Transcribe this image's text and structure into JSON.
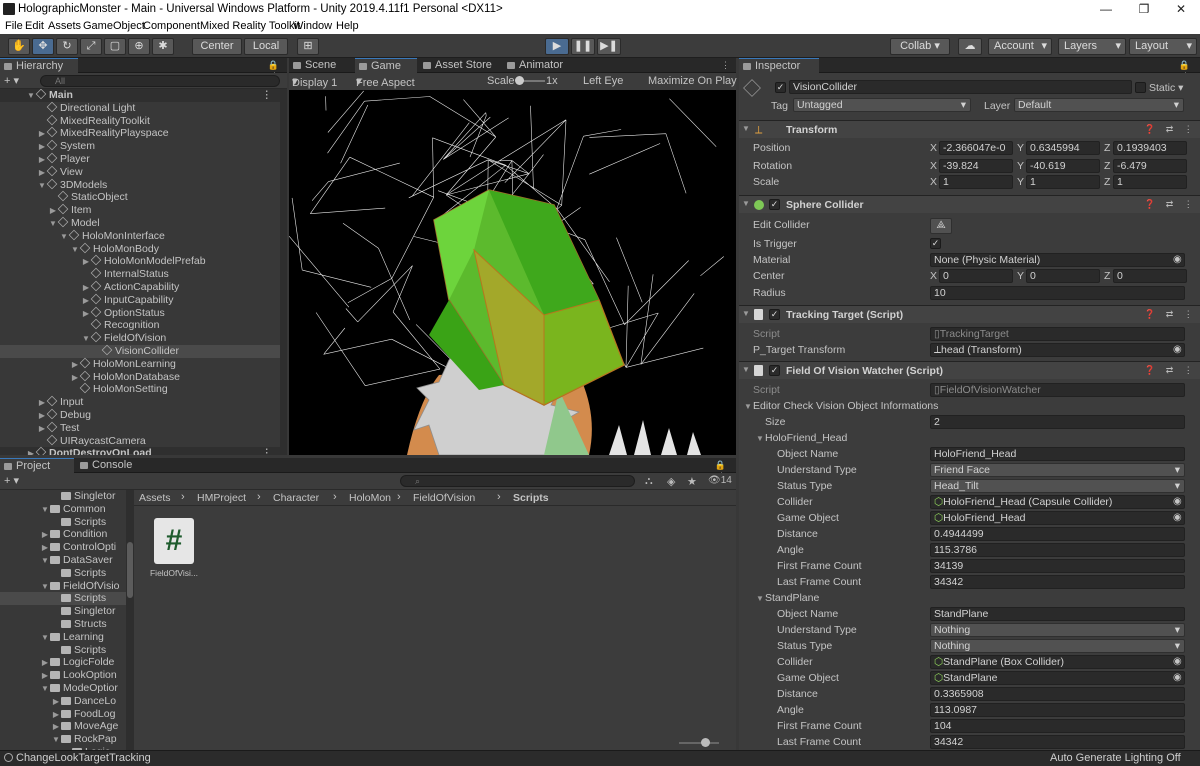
{
  "window": {
    "title": "HolographicMonster - Main - Universal Windows Platform - Unity 2019.4.11f1 Personal <DX11>",
    "minimize": "—",
    "maximize": "❐",
    "close": "✕"
  },
  "menu": [
    "File",
    "Edit",
    "Assets",
    "GameObject",
    "Component",
    "Mixed Reality Toolkit",
    "Window",
    "Help"
  ],
  "toolbar": {
    "center": "Center",
    "local": "Local",
    "collab": "Collab ▾",
    "account": "Account",
    "layers": "Layers",
    "layout": "Layout",
    "cloud_icon": "cloud-icon"
  },
  "hierarchy": {
    "tab": "Hierarchy",
    "add": "+ ▾",
    "search_placeholder": "All",
    "rows": [
      {
        "label": "Main",
        "depth": 0,
        "arrow": "▼",
        "scene": true
      },
      {
        "label": "Directional Light",
        "depth": 1,
        "arrow": ""
      },
      {
        "label": "MixedRealityToolkit",
        "depth": 1,
        "arrow": ""
      },
      {
        "label": "MixedRealityPlayspace",
        "depth": 1,
        "arrow": "▶"
      },
      {
        "label": "System",
        "depth": 1,
        "arrow": "▶"
      },
      {
        "label": "Player",
        "depth": 1,
        "arrow": "▶"
      },
      {
        "label": "View",
        "depth": 1,
        "arrow": "▶"
      },
      {
        "label": "3DModels",
        "depth": 1,
        "arrow": "▼"
      },
      {
        "label": "StaticObject",
        "depth": 2,
        "arrow": ""
      },
      {
        "label": "Item",
        "depth": 2,
        "arrow": "▶"
      },
      {
        "label": "Model",
        "depth": 2,
        "arrow": "▼"
      },
      {
        "label": "HoloMonInterface",
        "depth": 3,
        "arrow": "▼"
      },
      {
        "label": "HoloMonBody",
        "depth": 4,
        "arrow": "▼"
      },
      {
        "label": "HoloMonModelPrefab",
        "depth": 5,
        "arrow": "▶"
      },
      {
        "label": "InternalStatus",
        "depth": 5,
        "arrow": ""
      },
      {
        "label": "ActionCapability",
        "depth": 5,
        "arrow": "▶"
      },
      {
        "label": "InputCapability",
        "depth": 5,
        "arrow": "▶"
      },
      {
        "label": "OptionStatus",
        "depth": 5,
        "arrow": "▶"
      },
      {
        "label": "Recognition",
        "depth": 5,
        "arrow": ""
      },
      {
        "label": "FieldOfVision",
        "depth": 5,
        "arrow": "▼"
      },
      {
        "label": "VisionCollider",
        "depth": 6,
        "arrow": "",
        "selected": true
      },
      {
        "label": "HoloMonLearning",
        "depth": 4,
        "arrow": "▶"
      },
      {
        "label": "HoloMonDatabase",
        "depth": 4,
        "arrow": "▶"
      },
      {
        "label": "HoloMonSetting",
        "depth": 4,
        "arrow": ""
      },
      {
        "label": "Input",
        "depth": 1,
        "arrow": "▶"
      },
      {
        "label": "Debug",
        "depth": 1,
        "arrow": "▶"
      },
      {
        "label": "Test",
        "depth": 1,
        "arrow": "▶"
      },
      {
        "label": "UIRaycastCamera",
        "depth": 1,
        "arrow": ""
      },
      {
        "label": "DontDestroyOnLoad",
        "depth": 0,
        "arrow": "▶",
        "scene": true
      }
    ]
  },
  "scene_tabs": {
    "scene": "Scene",
    "game": "Game",
    "asset_store": "Asset Store",
    "animator": "Animator"
  },
  "game_toolbar": {
    "display": "Display 1",
    "aspect": "Free Aspect",
    "scale_label": "Scale",
    "scale_value": "1x",
    "eye": "Left Eye",
    "maximize": "Maximize On Play"
  },
  "project": {
    "tab_project": "Project",
    "tab_console": "Console",
    "add": "+ ▾",
    "count": "14",
    "breadcrumb": [
      "Assets",
      "HMProject",
      "Character",
      "HoloMon",
      "FieldOfVision",
      "Scripts"
    ],
    "file": "FieldOfVisi...",
    "tree": [
      {
        "label": "Singletor",
        "depth": 3,
        "arrow": ""
      },
      {
        "label": "Common",
        "depth": 2,
        "arrow": "▼"
      },
      {
        "label": "Scripts",
        "depth": 3,
        "arrow": ""
      },
      {
        "label": "Condition",
        "depth": 2,
        "arrow": "▶"
      },
      {
        "label": "ControlOpti",
        "depth": 2,
        "arrow": "▶"
      },
      {
        "label": "DataSaver",
        "depth": 2,
        "arrow": "▼"
      },
      {
        "label": "Scripts",
        "depth": 3,
        "arrow": ""
      },
      {
        "label": "FieldOfVisio",
        "depth": 2,
        "arrow": "▼"
      },
      {
        "label": "Scripts",
        "depth": 3,
        "arrow": "",
        "selected": true
      },
      {
        "label": "Singletor",
        "depth": 3,
        "arrow": ""
      },
      {
        "label": "Structs",
        "depth": 3,
        "arrow": ""
      },
      {
        "label": "Learning",
        "depth": 2,
        "arrow": "▼"
      },
      {
        "label": "Scripts",
        "depth": 3,
        "arrow": ""
      },
      {
        "label": "LogicFolde",
        "depth": 2,
        "arrow": "▶"
      },
      {
        "label": "LookOption",
        "depth": 2,
        "arrow": "▶"
      },
      {
        "label": "ModeOptior",
        "depth": 2,
        "arrow": "▼"
      },
      {
        "label": "DanceLo",
        "depth": 3,
        "arrow": "▶"
      },
      {
        "label": "FoodLog",
        "depth": 3,
        "arrow": "▶"
      },
      {
        "label": "MoveAge",
        "depth": 3,
        "arrow": "▶"
      },
      {
        "label": "RockPap",
        "depth": 3,
        "arrow": "▼"
      },
      {
        "label": "Logic",
        "depth": 4,
        "arrow": ""
      }
    ]
  },
  "inspector": {
    "tab": "Inspector",
    "object_name": "VisionCollider",
    "static_label": "Static ▾",
    "tag_label": "Tag",
    "tag_value": "Untagged",
    "layer_label": "Layer",
    "layer_value": "Default",
    "transform": {
      "title": "Transform",
      "position": {
        "label": "Position",
        "x": "-2.366047e-0",
        "y": "0.6345994",
        "z": "0.1939403"
      },
      "rotation": {
        "label": "Rotation",
        "x": "-39.824",
        "y": "-40.619",
        "z": "-6.479"
      },
      "scale": {
        "label": "Scale",
        "x": "1",
        "y": "1",
        "z": "1"
      }
    },
    "sphere": {
      "title": "Sphere Collider",
      "edit": "Edit Collider",
      "trigger": "Is Trigger",
      "material_label": "Material",
      "material_value": "None (Physic Material)",
      "center_label": "Center",
      "cx": "0",
      "cy": "0",
      "cz": "0",
      "radius_label": "Radius",
      "radius_value": "10"
    },
    "tracking": {
      "title": "Tracking Target (Script)",
      "script_label": "Script",
      "script_value": "TrackingTarget",
      "target_label": "P_Target Transform",
      "target_value": "head (Transform)"
    },
    "fov": {
      "title": "Field Of Vision Watcher (Script)",
      "script_label": "Script",
      "script_value": "FieldOfVisionWatcher",
      "section": "Editor Check Vision Object Informations",
      "size_label": "Size",
      "size_value": "2",
      "items": [
        {
          "name": "HoloFriend_Head",
          "fields": [
            [
              "Object Name",
              "HoloFriend_Head",
              "t"
            ],
            [
              "Understand Type",
              "Friend Face",
              "d"
            ],
            [
              "Status Type",
              "Head_Tilt",
              "d"
            ],
            [
              "Collider",
              "HoloFriend_Head (Capsule Collider)",
              "o"
            ],
            [
              "Game Object",
              "HoloFriend_Head",
              "o"
            ],
            [
              "Distance",
              "0.4944499",
              "t"
            ],
            [
              "Angle",
              "115.3786",
              "t"
            ],
            [
              "First Frame Count",
              "34139",
              "t"
            ],
            [
              "Last Frame Count",
              "34342",
              "t"
            ]
          ]
        },
        {
          "name": "StandPlane",
          "fields": [
            [
              "Object Name",
              "StandPlane",
              "t"
            ],
            [
              "Understand Type",
              "Nothing",
              "d"
            ],
            [
              "Status Type",
              "Nothing",
              "d"
            ],
            [
              "Collider",
              "StandPlane (Box Collider)",
              "o"
            ],
            [
              "Game Object",
              "StandPlane",
              "o"
            ],
            [
              "Distance",
              "0.3365908",
              "t"
            ],
            [
              "Angle",
              "113.0987",
              "t"
            ],
            [
              "First Frame Count",
              "104",
              "t"
            ],
            [
              "Last Frame Count",
              "34342",
              "t"
            ]
          ]
        }
      ]
    }
  },
  "status": {
    "left": "ChangeLookTargetTracking",
    "right": "Auto Generate Lighting Off"
  },
  "colors": {
    "accent": "#3a79bb",
    "play_active": "#4a6b91"
  }
}
